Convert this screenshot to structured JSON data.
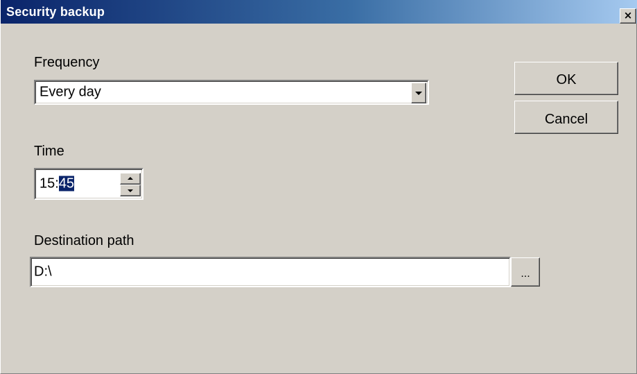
{
  "window": {
    "title": "Security backup",
    "close_glyph": "×"
  },
  "frequency": {
    "label": "Frequency",
    "selected": "Every day"
  },
  "time": {
    "label": "Time",
    "hours": "15",
    "separator": ":",
    "minutes": "45"
  },
  "destination": {
    "label": "Destination path",
    "value": "D:\\",
    "browse_label": "..."
  },
  "buttons": {
    "ok": "OK",
    "cancel": "Cancel"
  },
  "colors": {
    "titlebar_start": "#0a246a",
    "titlebar_end": "#a6caf0",
    "face": "#d4d0c8",
    "selection": "#0a246a"
  },
  "icons": {
    "close": "close-icon",
    "dropdown": "chevron-down-icon",
    "spin_up": "arrow-up-icon",
    "spin_down": "arrow-down-icon"
  }
}
